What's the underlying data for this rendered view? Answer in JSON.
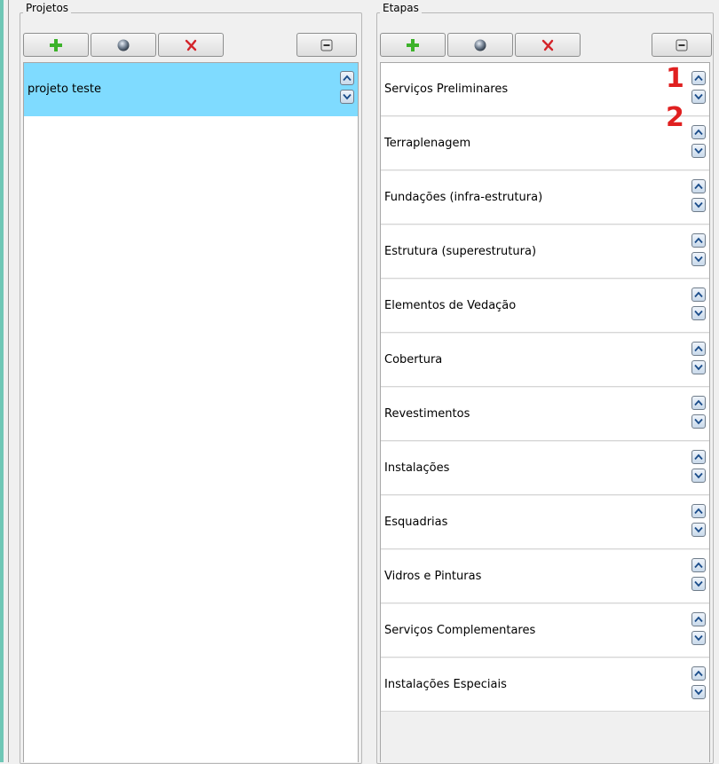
{
  "projetos": {
    "title": "Projetos",
    "toolbar": {
      "add_icon": "plus-icon",
      "edit_icon": "globe-icon",
      "delete_icon": "delete-x-icon",
      "collapse_icon": "minus-icon"
    },
    "items": [
      {
        "label": "projeto teste",
        "selected": true
      }
    ]
  },
  "etapas": {
    "title": "Etapas",
    "toolbar": {
      "add_icon": "plus-icon",
      "edit_icon": "globe-icon",
      "delete_icon": "delete-x-icon",
      "collapse_icon": "minus-icon"
    },
    "items": [
      {
        "label": "Serviços Preliminares"
      },
      {
        "label": "Terraplenagem"
      },
      {
        "label": "Fundações (infra-estrutura)"
      },
      {
        "label": "Estrutura (superestrutura)"
      },
      {
        "label": "Elementos de Vedação"
      },
      {
        "label": "Cobertura"
      },
      {
        "label": "Revestimentos"
      },
      {
        "label": "Instalações"
      },
      {
        "label": "Esquadrias"
      },
      {
        "label": "Vidros e Pinturas"
      },
      {
        "label": "Serviços Complementares"
      },
      {
        "label": "Instalações Especiais"
      }
    ]
  },
  "annotations": {
    "one": "1",
    "two": "2"
  },
  "colors": {
    "selection": "#7fdbff",
    "annotation": "#e02020",
    "add_icon": "#3cb22a",
    "delete_icon": "#d4242a"
  }
}
